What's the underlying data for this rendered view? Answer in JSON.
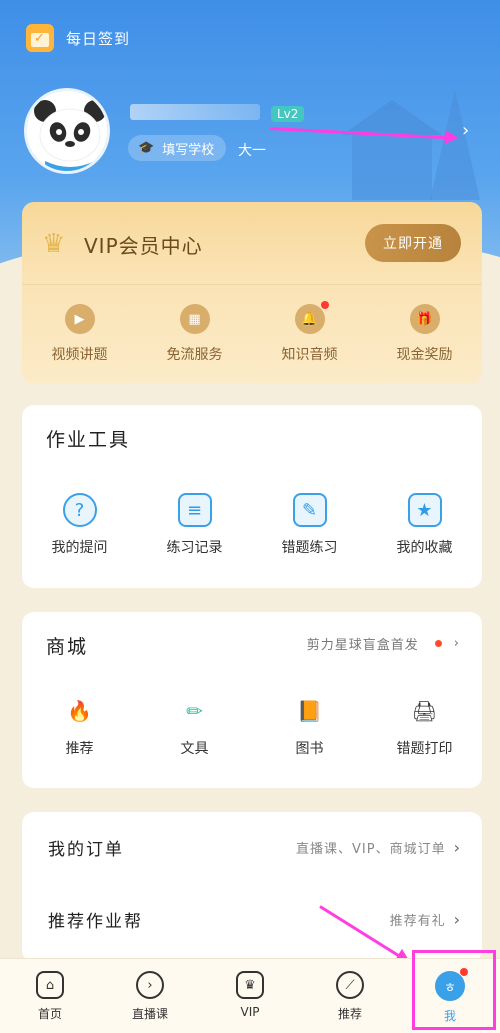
{
  "checkin": {
    "label": "每日签到",
    "icon": "calendar-check-icon"
  },
  "profile": {
    "level": "Lv2",
    "school_label": "填写学校",
    "grade": "大一",
    "chevron": "›"
  },
  "vip": {
    "title": "VIP会员中心",
    "button": "立即开通",
    "items": [
      {
        "label": "视频讲题",
        "icon": "play-video-icon",
        "glyph": "▶",
        "dot": false
      },
      {
        "label": "免流服务",
        "icon": "sim-card-icon",
        "glyph": "▦",
        "dot": false
      },
      {
        "label": "知识音频",
        "icon": "bell-icon",
        "glyph": "🔔",
        "dot": true
      },
      {
        "label": "现金奖励",
        "icon": "gift-icon",
        "glyph": "🎁",
        "dot": false
      }
    ]
  },
  "tools": {
    "title": "作业工具",
    "items": [
      {
        "label": "我的提问",
        "icon": "question-icon",
        "glyph": "?"
      },
      {
        "label": "练习记录",
        "icon": "record-icon",
        "glyph": "≡"
      },
      {
        "label": "错题练习",
        "icon": "wrong-question-icon",
        "glyph": "✎"
      },
      {
        "label": "我的收藏",
        "icon": "bookmark-icon",
        "glyph": "★"
      }
    ]
  },
  "mall": {
    "title": "商城",
    "promo": "剪力星球盲盒首发",
    "items": [
      {
        "label": "推荐",
        "icon": "flame-icon",
        "glyph": "🔥",
        "color": "#ff8a2a"
      },
      {
        "label": "文具",
        "icon": "pencil-icon",
        "glyph": "✏",
        "color": "#2fbfa0"
      },
      {
        "label": "图书",
        "icon": "book-icon",
        "glyph": "📙",
        "color": "#f4b400"
      },
      {
        "label": "错题打印",
        "icon": "printer-icon",
        "glyph": "🖨",
        "color": "#32b6c9"
      }
    ]
  },
  "orders": {
    "rows": [
      {
        "title": "我的订单",
        "value": "直播课、VIP、商城订单"
      },
      {
        "title": "推荐作业帮",
        "value": "推荐有礼"
      }
    ]
  },
  "tabbar": {
    "tabs": [
      {
        "label": "首页",
        "icon": "home-icon",
        "glyph": "⌂"
      },
      {
        "label": "直播课",
        "icon": "live-play-icon",
        "glyph": "›"
      },
      {
        "label": "VIP",
        "icon": "vip-crown-icon",
        "glyph": "♛"
      },
      {
        "label": "推荐",
        "icon": "recommend-icon",
        "glyph": "⟋"
      },
      {
        "label": "我",
        "icon": "me-icon",
        "glyph": "ㅎ",
        "active": true
      }
    ]
  },
  "colors": {
    "accent": "#3aa0e8",
    "annotation": "#ff3de0",
    "vip_gold": "#b7833c"
  }
}
